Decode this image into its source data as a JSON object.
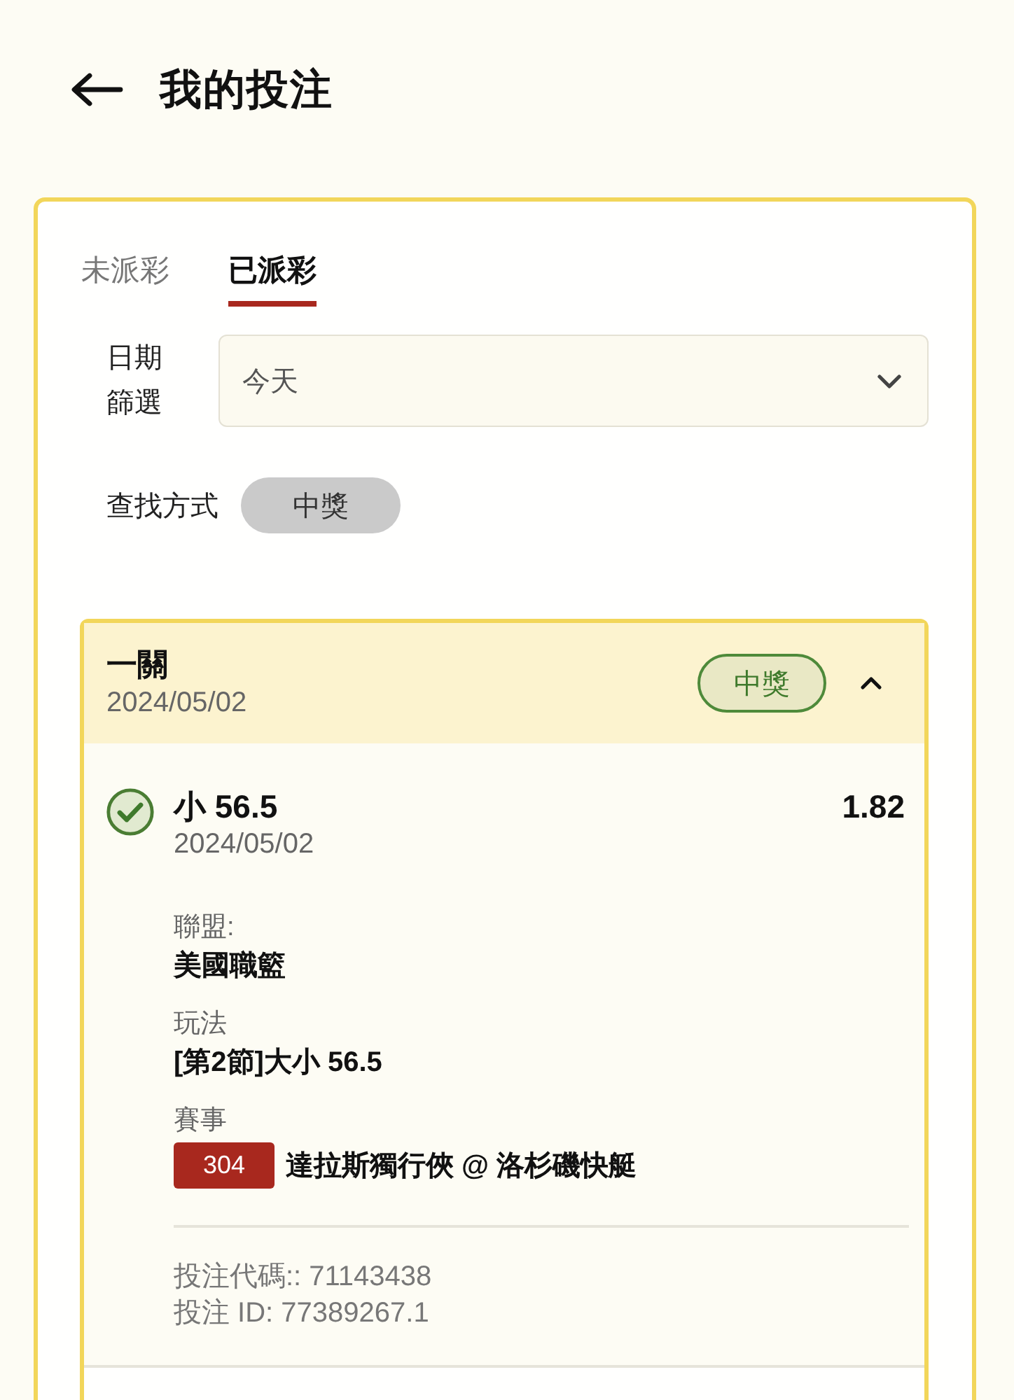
{
  "header": {
    "title": "我的投注"
  },
  "tabs": [
    {
      "label": "未派彩",
      "selected": false
    },
    {
      "label": "已派彩",
      "selected": true
    }
  ],
  "date_filter": {
    "label": "日期篩選",
    "value": "今天"
  },
  "search_mode": {
    "label": "查找方式",
    "chips": [
      {
        "label": "中獎",
        "selected": true
      }
    ]
  },
  "bets": [
    {
      "title": "一關",
      "date": "2024/05/02",
      "status": {
        "label": "中獎",
        "kind": "won"
      },
      "expanded": true,
      "legs": [
        {
          "won": true,
          "selection": "小 56.5",
          "date": "2024/05/02",
          "odds": "1.82",
          "fields": [
            {
              "kind": "text",
              "label": "聯盟:",
              "value": "美國職籃"
            },
            {
              "kind": "text",
              "label": "玩法",
              "value": "[第2節]大小 56.5"
            },
            {
              "kind": "match",
              "label": "賽事",
              "code": "304",
              "value": "達拉斯獨行俠 @ 洛杉磯快艇"
            }
          ],
          "bet_code": "投注代碼:: 71143438",
          "bet_id": "投注 ID: 77389267.1"
        }
      ]
    }
  ]
}
